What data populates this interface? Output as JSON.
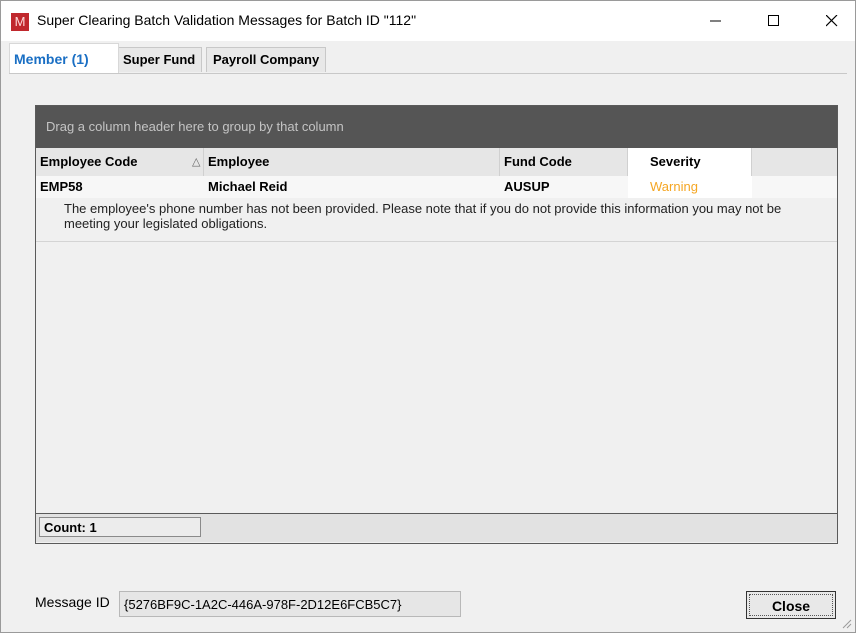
{
  "window": {
    "title": "Super Clearing Batch Validation Messages for Batch ID \"112\"",
    "app_icon_letter": "M"
  },
  "tabs": [
    {
      "label": "Member (1)",
      "active": true
    },
    {
      "label": "Super Fund",
      "active": false
    },
    {
      "label": "Payroll Company",
      "active": false
    }
  ],
  "grid": {
    "group_panel_text": "Drag a column header here to group by that column",
    "columns": [
      "Employee Code",
      "Employee",
      "Fund Code",
      "Severity"
    ],
    "sort_column": "Employee Code",
    "sort_glyph": "△",
    "rows": [
      {
        "employee_code": "EMP58",
        "employee": "Michael Reid",
        "fund_code": "AUSUP",
        "severity": "Warning",
        "message": "The employee's phone number has not been provided. Please note that if you do not provide this information you may not be meeting your legislated obligations."
      }
    ],
    "count_label": "Count: 1"
  },
  "footer": {
    "message_id_label": "Message ID",
    "message_id_value": "{5276BF9C-1A2C-446A-978F-2D12E6FCB5C7}",
    "close_label": "Close"
  },
  "colors": {
    "warning": "#f5a623",
    "active_tab": "#1a6fc4",
    "group_panel": "#555555",
    "app_icon": "#c0282d"
  }
}
